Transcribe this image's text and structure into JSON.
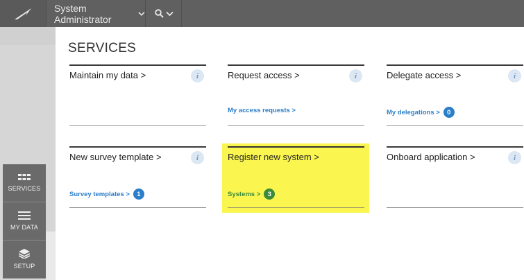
{
  "header": {
    "user_label": "System Administrator",
    "icons": [
      "logo-icon",
      "chevron-down-icon",
      "search-icon",
      "chevron-down-icon"
    ]
  },
  "nav": {
    "items": [
      {
        "label": "SERVICES",
        "icon": "grid-icon"
      },
      {
        "label": "MY DATA",
        "icon": "menu-lines-icon"
      },
      {
        "label": "SETUP",
        "icon": "layers-icon"
      }
    ]
  },
  "page": {
    "title": "SERVICES"
  },
  "tiles": [
    {
      "title": "Maintain my data >",
      "link": "",
      "badge": ""
    },
    {
      "title": "Request access >",
      "link": "My access requests >",
      "badge": ""
    },
    {
      "title": "Delegate access >",
      "link": "My delegations >",
      "badge": "0"
    },
    {
      "title": "New survey template >",
      "link": "Survey templates >",
      "badge": "1"
    },
    {
      "title": "Register new system >",
      "link": "Systems >",
      "badge": "3"
    },
    {
      "title": "Onboard application >",
      "link": "",
      "badge": ""
    }
  ],
  "colors": {
    "highlight": "#faf64f",
    "badge_blue": "#2b7ec9",
    "badge_green": "#3c8a3a",
    "link": "#2b7ec9"
  }
}
